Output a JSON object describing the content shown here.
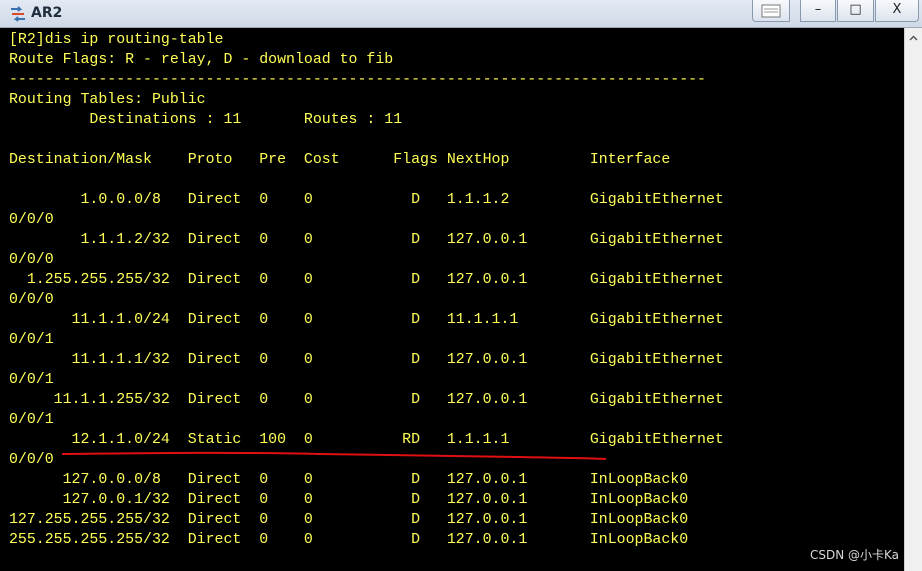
{
  "window": {
    "title": "AR2"
  },
  "title_buttons": {
    "minimize": "–",
    "maximize": "□",
    "close": "X"
  },
  "terminal": {
    "lines": [
      "[R2]dis ip routing-table",
      "Route Flags: R - relay, D - download to fib",
      "------------------------------------------------------------------------------",
      "Routing Tables: Public",
      "         Destinations : 11       Routes : 11",
      "",
      "Destination/Mask    Proto   Pre  Cost      Flags NextHop         Interface",
      "",
      "        1.0.0.0/8   Direct  0    0           D   1.1.1.2         GigabitEthernet",
      "0/0/0",
      "        1.1.1.2/32  Direct  0    0           D   127.0.0.1       GigabitEthernet",
      "0/0/0",
      "  1.255.255.255/32  Direct  0    0           D   127.0.0.1       GigabitEthernet",
      "0/0/0",
      "       11.1.1.0/24  Direct  0    0           D   11.1.1.1        GigabitEthernet",
      "0/0/1",
      "       11.1.1.1/32  Direct  0    0           D   127.0.0.1       GigabitEthernet",
      "0/0/1",
      "     11.1.1.255/32  Direct  0    0           D   127.0.0.1       GigabitEthernet",
      "0/0/1",
      "       12.1.1.0/24  Static  100  0          RD   1.1.1.1         GigabitEthernet",
      "0/0/0",
      "      127.0.0.0/8   Direct  0    0           D   127.0.0.1       InLoopBack0",
      "      127.0.0.1/32  Direct  0    0           D   127.0.0.1       InLoopBack0",
      "127.255.255.255/32  Direct  0    0           D   127.0.0.1       InLoopBack0",
      "255.255.255.255/32  Direct  0    0           D   127.0.0.1       InLoopBack0"
    ]
  },
  "watermark": "CSDN @小卡Ka",
  "colors": {
    "text": "#ffff55",
    "background": "#000000",
    "annotation": "#e01010"
  }
}
